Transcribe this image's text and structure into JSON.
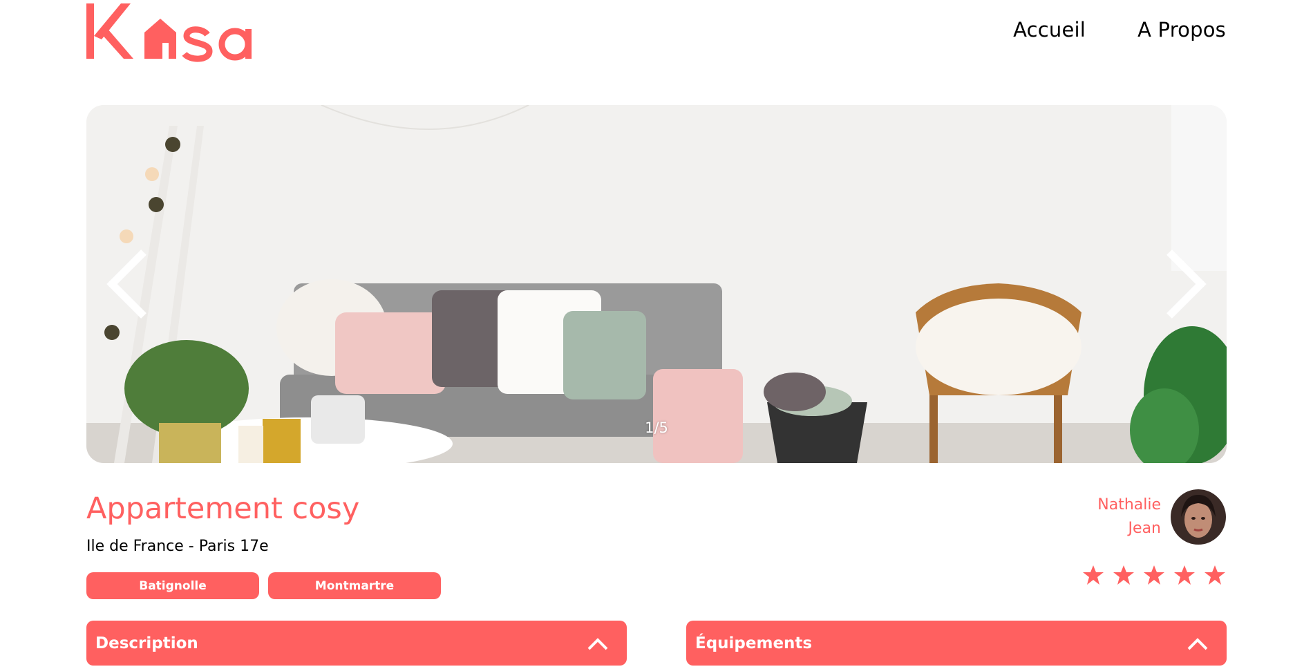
{
  "header": {
    "logo_text": "Kasa",
    "nav": [
      {
        "label": "Accueil"
      },
      {
        "label": "A Propos"
      }
    ]
  },
  "gallery": {
    "counter": "1/5",
    "prev_icon": "chevron-left-icon",
    "next_icon": "chevron-right-icon"
  },
  "listing": {
    "title": "Appartement cosy",
    "location": "Ile de France - Paris 17e",
    "tags": [
      "Batignolle",
      "Montmartre"
    ]
  },
  "host": {
    "first_name": "Nathalie",
    "last_name": "Jean",
    "rating": 5,
    "rating_max": 5
  },
  "collapses": [
    {
      "label": "Description",
      "icon": "chevron-up-icon"
    },
    {
      "label": "Équipements",
      "icon": "chevron-up-icon"
    }
  ],
  "colors": {
    "accent": "#FF6060",
    "text": "#000000",
    "background": "#FFFFFF"
  }
}
